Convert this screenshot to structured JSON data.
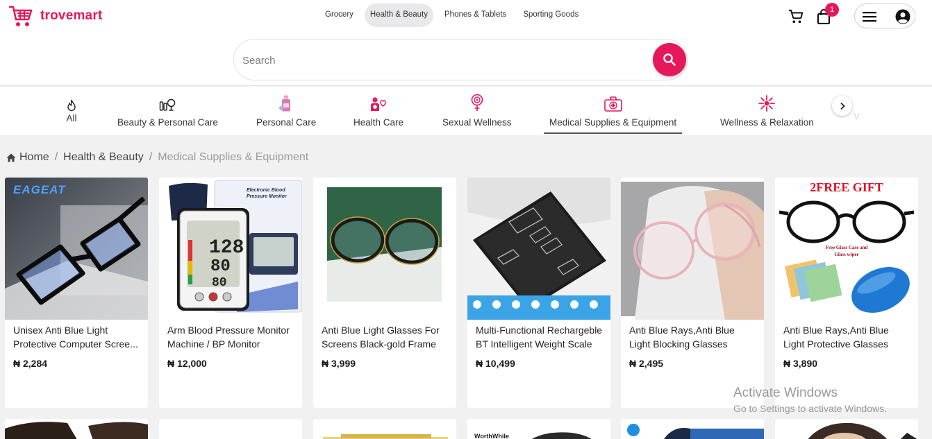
{
  "brand": {
    "name": "trovemart",
    "accent": "#e5185b"
  },
  "topnav": [
    {
      "label": "Grocery",
      "active": false
    },
    {
      "label": "Health & Beauty",
      "active": true
    },
    {
      "label": "Phones & Tablets",
      "active": false
    },
    {
      "label": "Sporting Goods",
      "active": false
    }
  ],
  "header_icons": {
    "cart": "cart-icon",
    "bag": "shopping-bag-icon",
    "bag_badge": "1",
    "menu": "hamburger-menu-icon",
    "account": "account-circle-icon"
  },
  "search": {
    "placeholder": "Search",
    "value": "",
    "button_icon": "search-icon"
  },
  "categories": [
    {
      "label": "All",
      "icon": "flame-icon"
    },
    {
      "label": "Beauty & Personal Care",
      "icon": "cosmetics-icon"
    },
    {
      "label": "Personal Care",
      "icon": "lotion-bottle-icon"
    },
    {
      "label": "Health Care",
      "icon": "health-care-icon"
    },
    {
      "label": "Sexual Wellness",
      "icon": "sexual-wellness-icon"
    },
    {
      "label": "Medical Supplies & Equipment",
      "icon": "first-aid-kit-icon",
      "active": true
    },
    {
      "label": "Wellness & Relaxation",
      "icon": "wellness-icon"
    }
  ],
  "category_overflow_hint": "V",
  "breadcrumb": {
    "home": "Home",
    "parent": "Health & Beauty",
    "current": "Medical Supplies & Equipment"
  },
  "products": [
    {
      "title": "Unisex Anti Blue Light Protective Computer Scree...",
      "price": "₦ 2,284",
      "image_text": "EAGEAT"
    },
    {
      "title": "Arm Blood Pressure Monitor Machine / BP Monitor",
      "price": "₦ 12,000",
      "image_text": "Electronic Blood Pressure Monitor"
    },
    {
      "title": "Anti Blue Light Glasses For Screens Black-gold Frame",
      "price": "₦ 3,999"
    },
    {
      "title": "Multi-Functional Rechargeble BT Intelligent Weight Scale",
      "price": "₦ 10,499"
    },
    {
      "title": "Anti Blue Rays,Anti Blue Light Blocking Glasses",
      "price": "₦ 2,495"
    },
    {
      "title": "Anti Blue Rays,Anti Blue Light Protective Glasses",
      "price": "₦ 3,890",
      "image_text": "2FREE GIFT",
      "image_subtext": "Free Glass Case and Glass wiper"
    }
  ],
  "second_row_hints": {
    "brand_text": "WorthWhile"
  },
  "os_watermark": {
    "line1": "Activate Windows",
    "line2": "Go to Settings to activate Windows."
  }
}
